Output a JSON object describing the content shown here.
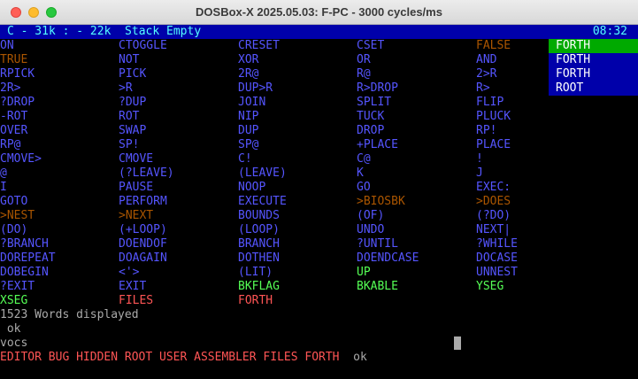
{
  "window": {
    "title": "DOSBox-X 2025.05.03: F-PC - 3000 cycles/ms"
  },
  "status_bar": {
    "text": "C - 31k : - 22k  Stack Empty",
    "time": "08:32"
  },
  "colors": {
    "blue": "#5555ff",
    "red": "#ff5555",
    "green": "#55ff55",
    "orange": "#aa5500",
    "cyan": "#55ffff",
    "white": "#ffffff",
    "grey": "#aaaaaa"
  },
  "word_rows": [
    [
      [
        "ON",
        "blue"
      ],
      [
        "CTOGGLE",
        "blue"
      ],
      [
        "CRESET",
        "blue"
      ],
      [
        "CSET",
        "blue"
      ],
      [
        "FALSE",
        "orange"
      ]
    ],
    [
      [
        "TRUE",
        "orange"
      ],
      [
        "NOT",
        "blue"
      ],
      [
        "XOR",
        "blue"
      ],
      [
        "OR",
        "blue"
      ],
      [
        "AND",
        "blue"
      ]
    ],
    [
      [
        "RPICK",
        "blue"
      ],
      [
        "PICK",
        "blue"
      ],
      [
        "2R@",
        "blue"
      ],
      [
        "R@",
        "blue"
      ],
      [
        "2>R",
        "blue"
      ]
    ],
    [
      [
        "2R>",
        "blue"
      ],
      [
        ">R",
        "blue"
      ],
      [
        "DUP>R",
        "blue"
      ],
      [
        "R>DROP",
        "blue"
      ],
      [
        "R>",
        "blue"
      ]
    ],
    [
      [
        "?DROP",
        "blue"
      ],
      [
        "?DUP",
        "blue"
      ],
      [
        "JOIN",
        "blue"
      ],
      [
        "SPLIT",
        "blue"
      ],
      [
        "FLIP",
        "blue"
      ]
    ],
    [
      [
        "-ROT",
        "blue"
      ],
      [
        "ROT",
        "blue"
      ],
      [
        "NIP",
        "blue"
      ],
      [
        "TUCK",
        "blue"
      ],
      [
        "PLUCK",
        "blue"
      ]
    ],
    [
      [
        "OVER",
        "blue"
      ],
      [
        "SWAP",
        "blue"
      ],
      [
        "DUP",
        "blue"
      ],
      [
        "DROP",
        "blue"
      ],
      [
        "RP!",
        "blue"
      ]
    ],
    [
      [
        "RP@",
        "blue"
      ],
      [
        "SP!",
        "blue"
      ],
      [
        "SP@",
        "blue"
      ],
      [
        "+PLACE",
        "blue"
      ],
      [
        "PLACE",
        "blue"
      ]
    ],
    [
      [
        "CMOVE>",
        "blue"
      ],
      [
        "CMOVE",
        "blue"
      ],
      [
        "C!",
        "blue"
      ],
      [
        "C@",
        "blue"
      ],
      [
        "!",
        "blue"
      ]
    ],
    [
      [
        "@",
        "blue"
      ],
      [
        "(?LEAVE)",
        "blue"
      ],
      [
        "(LEAVE)",
        "blue"
      ],
      [
        "K",
        "blue"
      ],
      [
        "J",
        "blue"
      ]
    ],
    [
      [
        "I",
        "blue"
      ],
      [
        "PAUSE",
        "blue"
      ],
      [
        "NOOP",
        "blue"
      ],
      [
        "GO",
        "blue"
      ],
      [
        "EXEC:",
        "blue"
      ]
    ],
    [
      [
        "GOTO",
        "blue"
      ],
      [
        "PERFORM",
        "blue"
      ],
      [
        "EXECUTE",
        "blue"
      ],
      [
        ">BIOSBK",
        "orange"
      ],
      [
        ">DOES",
        "orange"
      ]
    ],
    [
      [
        ">NEST",
        "orange"
      ],
      [
        ">NEXT",
        "orange"
      ],
      [
        "BOUNDS",
        "blue"
      ],
      [
        "(OF)",
        "blue"
      ],
      [
        "(?DO)",
        "blue"
      ]
    ],
    [
      [
        "(DO)",
        "blue"
      ],
      [
        "(+LOOP)",
        "blue"
      ],
      [
        "(LOOP)",
        "blue"
      ],
      [
        "UNDO",
        "blue"
      ],
      [
        "NEXT|",
        "blue"
      ]
    ],
    [
      [
        "?BRANCH",
        "blue"
      ],
      [
        "DOENDOF",
        "blue"
      ],
      [
        "BRANCH",
        "blue"
      ],
      [
        "?UNTIL",
        "blue"
      ],
      [
        "?WHILE",
        "blue"
      ]
    ],
    [
      [
        "DOREPEAT",
        "blue"
      ],
      [
        "DOAGAIN",
        "blue"
      ],
      [
        "DOTHEN",
        "blue"
      ],
      [
        "DOENDCASE",
        "blue"
      ],
      [
        "DOCASE",
        "blue"
      ]
    ],
    [
      [
        "DOBEGIN",
        "blue"
      ],
      [
        "<'>",
        "blue"
      ],
      [
        "(LIT)",
        "blue"
      ],
      [
        "UP",
        "green"
      ],
      [
        "UNNEST",
        "blue"
      ]
    ],
    [
      [
        "?EXIT",
        "blue"
      ],
      [
        "EXIT",
        "blue"
      ],
      [
        "BKFLAG",
        "green"
      ],
      [
        "BKABLE",
        "green"
      ],
      [
        "YSEG",
        "green"
      ]
    ],
    [
      [
        "XSEG",
        "green"
      ],
      [
        "FILES",
        "red"
      ],
      [
        "FORTH",
        "red"
      ]
    ]
  ],
  "vocab_stack": [
    "FORTH",
    "FORTH",
    "FORTH",
    "ROOT"
  ],
  "terminal": {
    "words_displayed": "1523 Words displayed",
    "ok_line": " ok",
    "command": "vocs",
    "vocs_output": "EDITOR BUG HIDDEN ROOT USER ASSEMBLER FILES FORTH",
    "vocs_ok": "  ok"
  }
}
